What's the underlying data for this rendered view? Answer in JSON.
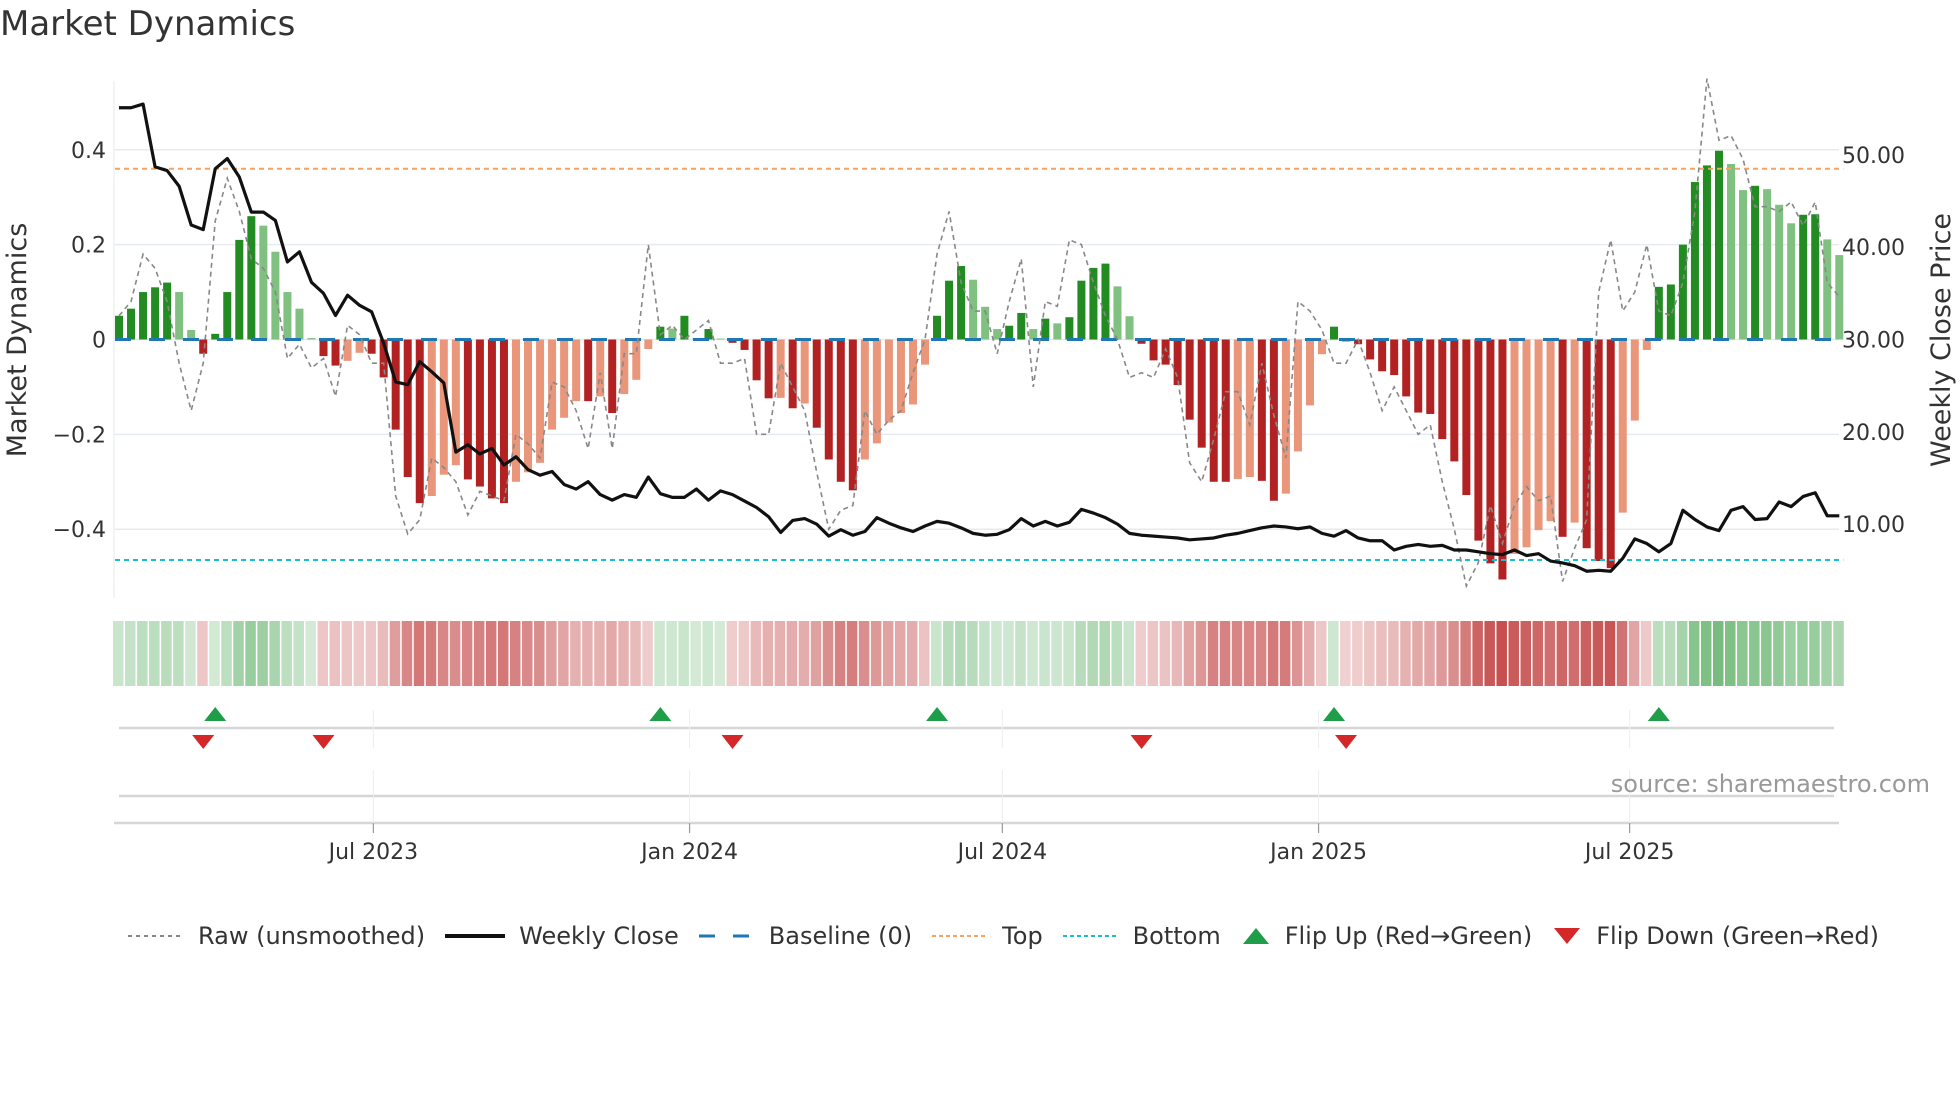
{
  "title": "Market Dynamics",
  "source": "source: sharemaestro.com",
  "colors": {
    "green_strong": "#228B22",
    "green_light": "#80C080",
    "red_strong": "#B22222",
    "red_light": "#E9967A",
    "baseline": "#1F77B4",
    "top": "#F4A460",
    "bottom": "#17BECF",
    "raw": "#888888",
    "close": "#111111",
    "flip_up": "#1E9E48",
    "flip_down": "#D62728"
  },
  "chart_data": {
    "type": "bar",
    "title": "Market Dynamics",
    "ylabel": "Market Dynamics",
    "y2label": "Weekly Close Price",
    "start_date": "2023-02-03",
    "frequency": "weekly",
    "ylim": [
      -0.545,
      0.545
    ],
    "y2lim": [
      2,
      58
    ],
    "yticks": [
      {
        "v": 0.4,
        "label": "0.4"
      },
      {
        "v": 0.2,
        "label": "0.2"
      },
      {
        "v": 0,
        "label": "0"
      },
      {
        "v": -0.2,
        "label": "−0.2"
      },
      {
        "v": -0.4,
        "label": "−0.4"
      }
    ],
    "y2ticks": [
      {
        "v": 50,
        "label": "50.00"
      },
      {
        "v": 40,
        "label": "40.00"
      },
      {
        "v": 30,
        "label": "30.00"
      },
      {
        "v": 20,
        "label": "20.00"
      },
      {
        "v": 10,
        "label": "10.00"
      }
    ],
    "xticks": [
      {
        "date": "2023-07-01",
        "label": "Jul 2023"
      },
      {
        "date": "2024-01-01",
        "label": "Jan 2024"
      },
      {
        "date": "2024-07-01",
        "label": "Jul 2024"
      },
      {
        "date": "2025-01-01",
        "label": "Jan 2025"
      },
      {
        "date": "2025-07-01",
        "label": "Jul 2025"
      }
    ],
    "top_level": 0.36,
    "bottom_level": -0.465,
    "baseline": 0,
    "momentum": [
      0.05,
      0.065,
      0.1,
      0.11,
      0.12,
      0.1,
      0.02,
      -0.03,
      0.012,
      0.1,
      0.21,
      0.26,
      0.24,
      0.185,
      0.1,
      0.065,
      0.003,
      -0.035,
      -0.055,
      -0.045,
      -0.028,
      -0.03,
      -0.08,
      -0.19,
      -0.29,
      -0.345,
      -0.33,
      -0.285,
      -0.265,
      -0.295,
      -0.31,
      -0.335,
      -0.345,
      -0.3,
      -0.28,
      -0.26,
      -0.19,
      -0.165,
      -0.13,
      -0.13,
      -0.12,
      -0.155,
      -0.115,
      -0.085,
      -0.02,
      0.027,
      0.023,
      0.05,
      0.002,
      0.022,
      0.002,
      -0.007,
      -0.022,
      -0.086,
      -0.124,
      -0.123,
      -0.145,
      -0.135,
      -0.186,
      -0.253,
      -0.3,
      -0.318,
      -0.253,
      -0.219,
      -0.175,
      -0.155,
      -0.137,
      -0.053,
      0.05,
      0.124,
      0.155,
      0.126,
      0.069,
      0.022,
      0.029,
      0.056,
      0.022,
      0.044,
      0.034,
      0.047,
      0.124,
      0.151,
      0.16,
      0.112,
      0.049,
      -0.009,
      -0.044,
      -0.053,
      -0.096,
      -0.169,
      -0.228,
      -0.3,
      -0.3,
      -0.294,
      -0.29,
      -0.298,
      -0.34,
      -0.325,
      -0.236,
      -0.139,
      -0.031,
      0.027,
      -0.004,
      -0.01,
      -0.042,
      -0.067,
      -0.075,
      -0.12,
      -0.154,
      -0.157,
      -0.21,
      -0.257,
      -0.328,
      -0.424,
      -0.472,
      -0.506,
      -0.452,
      -0.438,
      -0.402,
      -0.383,
      -0.416,
      -0.386,
      -0.44,
      -0.467,
      -0.482,
      -0.365,
      -0.171,
      -0.022,
      0.111,
      0.116,
      0.2,
      0.332,
      0.367,
      0.398,
      0.37,
      0.315,
      0.324,
      0.317,
      0.284,
      0.245,
      0.263,
      0.264,
      0.211,
      0.178
    ],
    "raw": [
      0.05,
      0.08,
      0.18,
      0.15,
      0.08,
      -0.05,
      -0.15,
      -0.05,
      0.25,
      0.34,
      0.27,
      0.17,
      0.15,
      0.1,
      -0.04,
      -0.01,
      -0.06,
      -0.04,
      -0.12,
      0.03,
      0.01,
      -0.05,
      -0.05,
      -0.33,
      -0.41,
      -0.38,
      -0.25,
      -0.27,
      -0.3,
      -0.37,
      -0.32,
      -0.33,
      -0.34,
      -0.2,
      -0.22,
      -0.25,
      -0.09,
      -0.1,
      -0.15,
      -0.23,
      -0.07,
      -0.23,
      -0.03,
      -0.03,
      0.2,
      0.01,
      0.03,
      0.0,
      0.02,
      0.04,
      -0.05,
      -0.05,
      -0.04,
      -0.2,
      -0.2,
      -0.05,
      -0.1,
      -0.15,
      -0.28,
      -0.4,
      -0.36,
      -0.35,
      -0.15,
      -0.2,
      -0.17,
      -0.15,
      -0.07,
      0.0,
      0.18,
      0.27,
      0.12,
      0.06,
      0.06,
      -0.03,
      0.08,
      0.17,
      -0.1,
      0.08,
      0.07,
      0.21,
      0.2,
      0.12,
      0.05,
      0.0,
      -0.08,
      -0.07,
      -0.08,
      -0.02,
      -0.08,
      -0.26,
      -0.3,
      -0.21,
      -0.11,
      -0.11,
      -0.18,
      -0.05,
      -0.16,
      -0.25,
      0.08,
      0.06,
      0.02,
      -0.05,
      -0.05,
      0.0,
      -0.07,
      -0.15,
      -0.1,
      -0.15,
      -0.2,
      -0.18,
      -0.3,
      -0.4,
      -0.52,
      -0.47,
      -0.35,
      -0.43,
      -0.35,
      -0.31,
      -0.34,
      -0.33,
      -0.51,
      -0.44,
      -0.38,
      0.1,
      0.21,
      0.06,
      0.1,
      0.2,
      0.06,
      0.05,
      0.12,
      0.27,
      0.55,
      0.42,
      0.43,
      0.38,
      0.28,
      0.28,
      0.27,
      0.29,
      0.24,
      0.29,
      0.12,
      0.09
    ],
    "close": [
      55.1,
      55.1,
      55.5,
      48.7,
      48.3,
      46.6,
      42.4,
      41.9,
      48.5,
      49.6,
      47.6,
      43.8,
      43.8,
      42.9,
      38.4,
      39.5,
      36.2,
      35,
      32.6,
      34.8,
      33.7,
      33,
      29.6,
      25.4,
      25.1,
      27.6,
      26.5,
      25.3,
      17.8,
      18.6,
      17.6,
      18.2,
      16.4,
      17.3,
      15.9,
      15.3,
      15.7,
      14.3,
      13.8,
      14.6,
      13.2,
      12.6,
      13.2,
      12.9,
      15.1,
      13.3,
      12.9,
      12.9,
      13.8,
      12.6,
      13.6,
      13.2,
      12.5,
      11.8,
      10.8,
      9.1,
      10.4,
      10.6,
      10.0,
      8.7,
      9.4,
      8.8,
      9.2,
      10.7,
      10.1,
      9.6,
      9.2,
      9.8,
      10.3,
      10.1,
      9.6,
      9.0,
      8.8,
      8.9,
      9.4,
      10.6,
      9.8,
      10.3,
      9.8,
      10.2,
      11.6,
      11.2,
      10.7,
      10.0,
      9.0,
      8.8,
      8.7,
      8.6,
      8.5,
      8.3,
      8.4,
      8.5,
      8.8,
      9.0,
      9.3,
      9.6,
      9.8,
      9.7,
      9.5,
      9.7,
      9.0,
      8.7,
      9.3,
      8.5,
      8.2,
      8.2,
      7.2,
      7.6,
      7.8,
      7.6,
      7.7,
      7.2,
      7.2,
      7.0,
      6.8,
      6.7,
      7.2,
      6.6,
      6.8,
      6.0,
      5.8,
      5.5,
      4.9,
      5.0,
      4.9,
      6.3,
      8.4,
      7.9,
      7.0,
      7.9,
      11.5,
      10.5,
      9.7,
      9.3,
      11.5,
      11.9,
      10.5,
      10.6,
      12.4,
      11.9,
      13.0,
      13.4,
      10.9,
      10.9
    ],
    "legend": [
      {
        "key": "raw",
        "label": "Raw (unsmoothed)"
      },
      {
        "key": "close",
        "label": "Weekly Close"
      },
      {
        "key": "baseline",
        "label": "Baseline (0)"
      },
      {
        "key": "top",
        "label": "Top"
      },
      {
        "key": "bottom",
        "label": "Bottom"
      },
      {
        "key": "flip_up",
        "label": "Flip Up (Red→Green)"
      },
      {
        "key": "flip_down",
        "label": "Flip Down (Green→Red)"
      }
    ],
    "legend_position": "bottom"
  }
}
